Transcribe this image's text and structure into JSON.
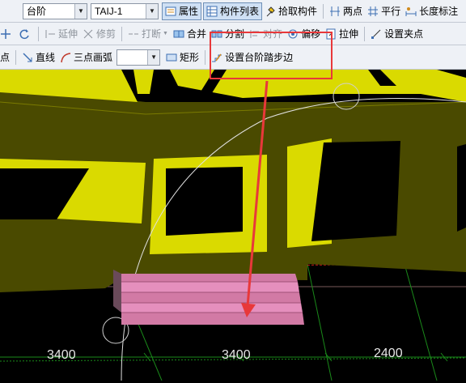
{
  "toolbar_row1": {
    "category_select": "台阶",
    "component_select": "TAIJ-1",
    "properties_label": "属性",
    "component_list_label": "构件列表",
    "pick_component_label": "拾取构件",
    "two_points_label": "两点",
    "parallel_label": "平行",
    "length_dim_label": "长度标注"
  },
  "toolbar_row2": {
    "extend_label": "延伸",
    "trim_label": "修剪",
    "break_label": "打断",
    "merge_label": "合并",
    "split_label": "分割",
    "align_label": "对齐",
    "offset_label": "偏移",
    "stretch_label": "拉伸",
    "set_grip_label": "设置夹点"
  },
  "toolbar_row3": {
    "point_label": "点",
    "line_label": "直线",
    "arc_label": "三点画弧",
    "arc_select": "",
    "rect_label": "矩形",
    "set_step_edge_label": "设置台阶踏步边"
  },
  "dimensions": [
    "3400",
    "3400",
    "2400"
  ],
  "colors": {
    "wall_face": "#4a4a00",
    "wall_top": "#dada00",
    "step_fill": "#d27aa5",
    "highlight": "#e8383a",
    "background": "#000000"
  }
}
